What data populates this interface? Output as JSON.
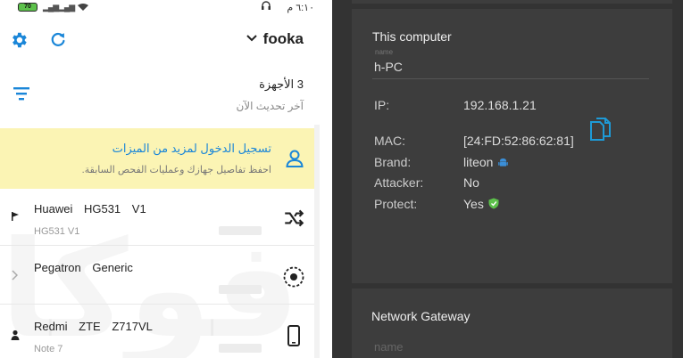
{
  "phone": {
    "status_bar": {
      "battery": "70",
      "time": "٦:١٠ م"
    },
    "top_bar": {
      "app_title": "fooka"
    },
    "devices_header": {
      "count_label": "3 الأجهزة",
      "last_update": "آخر تحديث الآن"
    },
    "banner": {
      "title": "تسجيل الدخول لمزيد من الميزات",
      "subtitle": "احفظ تفاصيل جهازك وعمليات الفحص السابقة."
    },
    "devices": [
      {
        "name": "Huawei HG531 V1",
        "sub": "HG531 V1",
        "lead_icon": "flag-icon",
        "icon": "shuffle-icon"
      },
      {
        "name": "Pegatron Generic",
        "sub": "",
        "lead_icon": "chevron-right-icon",
        "icon": "target-icon"
      },
      {
        "name": "Redmi ZTE Z717VL",
        "sub": "Note 7",
        "lead_icon": "person-icon",
        "icon": "phone-icon"
      }
    ],
    "icons": [
      "gear-icon",
      "refresh-icon",
      "chevron-down-icon",
      "filter-icon",
      "user-icon"
    ]
  },
  "details": {
    "card_title": "This computer",
    "name_label": "name",
    "name_value": "h-PC",
    "rows": {
      "ip": {
        "label": "IP:",
        "value": "192.168.1.21"
      },
      "mac": {
        "label": "MAC:",
        "value": "[24:FD:52:86:62:81]"
      },
      "brand": {
        "label": "Brand:",
        "value": "liteon"
      },
      "attacker": {
        "label": "Attacker:",
        "value": "No"
      },
      "protect": {
        "label": "Protect:",
        "value": "Yes"
      }
    },
    "gateway": {
      "title": "Network Gateway",
      "name_placeholder": "name"
    },
    "colors": {
      "accent": "#1e9ad6",
      "android": "#3b8fd8",
      "shield": "#5cc14a"
    }
  }
}
